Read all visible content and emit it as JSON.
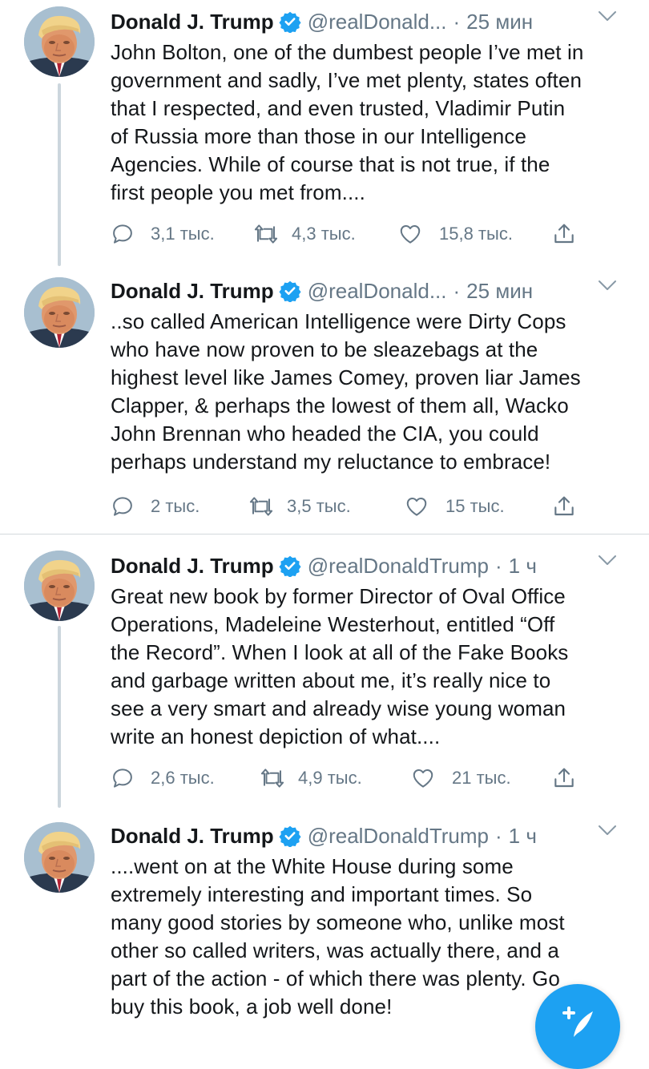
{
  "tweets": [
    {
      "name": "Donald J. Trump",
      "handle": "@realDonald...",
      "separator": "·",
      "time": "25 мин",
      "text": "John Bolton, one of the dumbest people I’ve met in\ngovernment and sadly, I’ve met plenty, states often\nthat I respected, and even trusted, Vladimir Putin\nof Russia more than those in our Intelligence\nAgencies. While of course that is not true, if the\nfirst people you met from....",
      "replies": "3,1 тыс.",
      "retweets": "4,3 тыс.",
      "likes": "15,8 тыс."
    },
    {
      "name": "Donald J. Trump",
      "handle": "@realDonald...",
      "separator": "·",
      "time": "25 мин",
      "text": "..so called American Intelligence were Dirty Cops\nwho have now proven to be sleazebags at the\nhighest level like James Comey, proven liar James\nClapper, & perhaps the lowest of them all, Wacko\nJohn Brennan who headed the CIA, you could\nperhaps understand my reluctance to embrace!",
      "replies": "2 тыс.",
      "retweets": "3,5 тыс.",
      "likes": "15 тыс."
    },
    {
      "name": "Donald J. Trump",
      "handle": "@realDonaldTrump",
      "separator": "·",
      "time": "1 ч",
      "text": "Great new book by former Director of Oval Office\nOperations, Madeleine Westerhout, entitled “Off\nthe Record”. When I look at all of the Fake Books\nand garbage written about me, it’s really nice to\nsee a very smart and already wise young woman\nwrite an honest depiction of what....",
      "replies": "2,6 тыс.",
      "retweets": "4,9 тыс.",
      "likes": "21 тыс."
    },
    {
      "name": "Donald J. Trump",
      "handle": "@realDonaldTrump",
      "separator": "·",
      "time": "1 ч",
      "text": "....went on at the White House during some\nextremely interesting and important times. So\nmany good stories by someone who, unlike most\nother so called writers, was actually there, and a\npart of the action - of which there was plenty. Go\nbuy this book, a job well done!"
    }
  ],
  "icons": {
    "verified": "verified-badge-icon",
    "caret": "chevron-down-icon",
    "reply": "reply-icon",
    "retweet": "retweet-icon",
    "like": "heart-icon",
    "share": "share-icon",
    "compose": "compose-tweet-icon"
  },
  "colors": {
    "brand_blue": "#1da1f2",
    "secondary_text": "#657786",
    "thread_line": "#ccd6dd",
    "divider": "#d4d8dc"
  }
}
